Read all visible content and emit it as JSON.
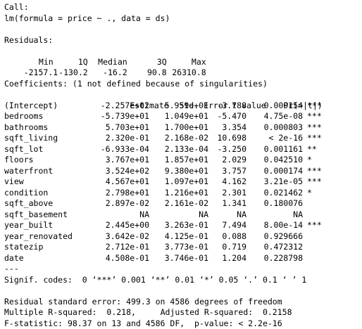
{
  "console": {
    "call_header": "Call:",
    "call": "lm(formula = price ~ ., data = ds)",
    "residuals_header": "Residuals:",
    "residuals_labels": [
      "Min",
      "1Q",
      "Median",
      "3Q",
      "Max"
    ],
    "residuals_values": [
      "-2157.1",
      "-130.2",
      "-16.2",
      "90.8",
      "26310.8"
    ],
    "coef_header": "Coefficients: (1 not defined because of singularities)",
    "coef_columns": [
      "Estimate",
      "Std. Error",
      "t value",
      "Pr(>|t|)"
    ],
    "coefficients": [
      {
        "name": "(Intercept)",
        "estimate": "-2.257e+02",
        "std_error": "5.959e+01",
        "t_value": "-3.788",
        "p_value": "0.000154",
        "stars": "***"
      },
      {
        "name": "bedrooms",
        "estimate": "-5.739e+01",
        "std_error": "1.049e+01",
        "t_value": "-5.470",
        "p_value": "4.75e-08",
        "stars": "***"
      },
      {
        "name": "bathrooms",
        "estimate": "5.703e+01",
        "std_error": "1.700e+01",
        "t_value": "3.354",
        "p_value": "0.000803",
        "stars": "***"
      },
      {
        "name": "sqft_living",
        "estimate": "2.320e-01",
        "std_error": "2.168e-02",
        "t_value": "10.698",
        "p_value": "< 2e-16",
        "stars": "***"
      },
      {
        "name": "sqft_lot",
        "estimate": "-6.933e-04",
        "std_error": "2.133e-04",
        "t_value": "-3.250",
        "p_value": "0.001161",
        "stars": "**"
      },
      {
        "name": "floors",
        "estimate": "3.767e+01",
        "std_error": "1.857e+01",
        "t_value": "2.029",
        "p_value": "0.042510",
        "stars": "*"
      },
      {
        "name": "waterfront",
        "estimate": "3.524e+02",
        "std_error": "9.380e+01",
        "t_value": "3.757",
        "p_value": "0.000174",
        "stars": "***"
      },
      {
        "name": "view",
        "estimate": "4.567e+01",
        "std_error": "1.097e+01",
        "t_value": "4.162",
        "p_value": "3.21e-05",
        "stars": "***"
      },
      {
        "name": "condition",
        "estimate": "2.798e+01",
        "std_error": "1.216e+01",
        "t_value": "2.301",
        "p_value": "0.021462",
        "stars": "*"
      },
      {
        "name": "sqft_above",
        "estimate": "2.897e-02",
        "std_error": "2.161e-02",
        "t_value": "1.341",
        "p_value": "0.180076",
        "stars": ""
      },
      {
        "name": "sqft_basement",
        "estimate": "NA",
        "std_error": "NA",
        "t_value": "NA",
        "p_value": "NA",
        "stars": ""
      },
      {
        "name": "year_built",
        "estimate": "2.445e+00",
        "std_error": "3.263e-01",
        "t_value": "7.494",
        "p_value": "8.00e-14",
        "stars": "***"
      },
      {
        "name": "year_renovated",
        "estimate": "3.642e-02",
        "std_error": "4.125e-01",
        "t_value": "0.088",
        "p_value": "0.929666",
        "stars": ""
      },
      {
        "name": "statezip",
        "estimate": "2.712e-01",
        "std_error": "3.773e-01",
        "t_value": "0.719",
        "p_value": "0.472312",
        "stars": ""
      },
      {
        "name": "date",
        "estimate": "4.508e-01",
        "std_error": "3.746e-01",
        "t_value": "1.204",
        "p_value": "0.228798",
        "stars": ""
      }
    ],
    "separator": "---",
    "signif_codes": "Signif. codes:  0 ‘***’ 0.001 ‘**’ 0.01 ‘*’ 0.05 ‘.’ 0.1 ‘ ’ 1",
    "residual_se": "Residual standard error: 499.3 on 4586 degrees of freedom",
    "r_squared": "Multiple R-squared:  0.218,\tAdjusted R-squared:  0.2158",
    "f_statistic": "F-statistic: 98.37 on 13 and 4586 DF,  p-value: < 2.2e-16"
  }
}
